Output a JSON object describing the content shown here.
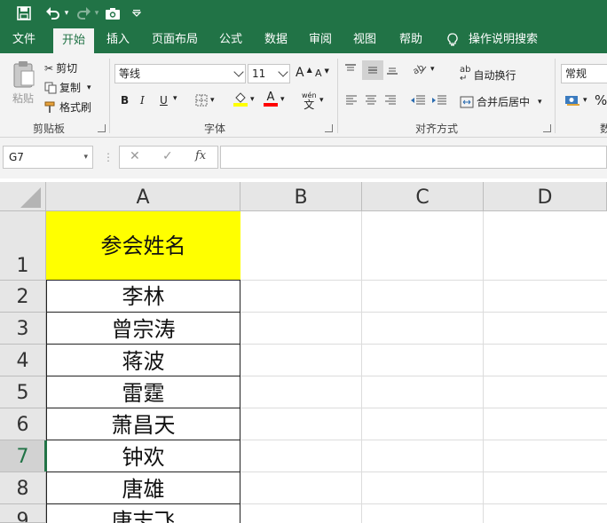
{
  "quick_access": {
    "save": "save-icon",
    "undo": "undo-icon",
    "redo": "redo-icon",
    "camera": "camera-icon",
    "customize": "chevron-down-icon"
  },
  "tabs": [
    "文件",
    "开始",
    "插入",
    "页面布局",
    "公式",
    "数据",
    "审阅",
    "视图",
    "帮助",
    "操作说明搜索"
  ],
  "active_tab": "开始",
  "clipboard": {
    "paste": "粘贴",
    "cut": "剪切",
    "copy": "复制",
    "format_painter": "格式刷",
    "group": "剪贴板"
  },
  "font": {
    "name": "等线",
    "size": "11",
    "bold": "B",
    "italic": "I",
    "underline": "U",
    "grow": "A",
    "shrink": "A",
    "phonetic": "wén",
    "phonetic_char": "文",
    "group": "字体"
  },
  "alignment": {
    "wrap": "自动换行",
    "merge": "合并后居中",
    "group": "对齐方式"
  },
  "number": {
    "format": "常规",
    "percent": "%",
    "group_partial": "数"
  },
  "formula_bar": {
    "name_box": "G7",
    "cancel": "✕",
    "enter": "✓",
    "fx": "fx",
    "value": ""
  },
  "columns": [
    "A",
    "B",
    "C",
    "D"
  ],
  "rows": [
    "1",
    "2",
    "3",
    "4",
    "5",
    "6",
    "7",
    "8",
    "9"
  ],
  "selected_row": "7",
  "cells": {
    "A1": "参会姓名",
    "A2": "李林",
    "A3": "曾宗涛",
    "A4": "蒋波",
    "A5": "雷霆",
    "A6": "萧昌天",
    "A7": "钟欢",
    "A8": "唐雄",
    "A9": "唐志飞"
  },
  "colors": {
    "brand": "#217346",
    "header_fill": "#ffff00",
    "font_color": "#ff0000",
    "highlight": "#ffff00"
  }
}
